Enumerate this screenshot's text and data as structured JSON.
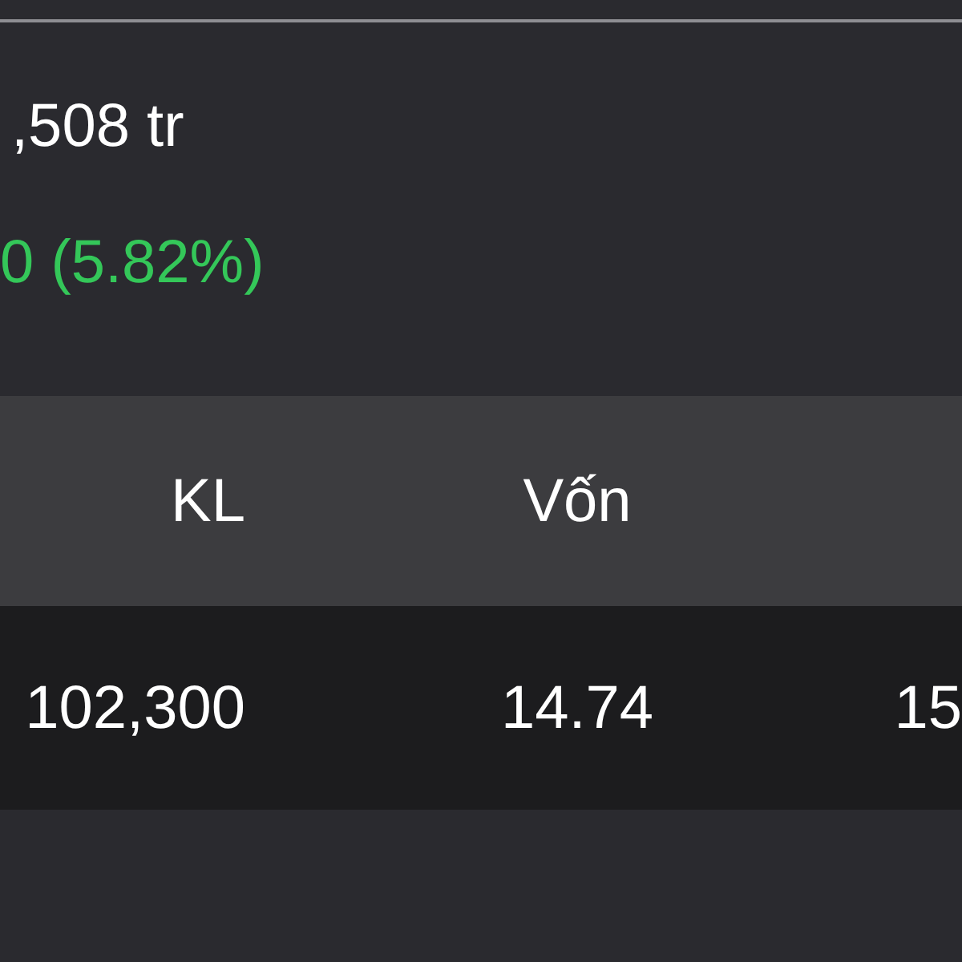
{
  "summary": {
    "value": ",508 tr",
    "change": "0 (5.82%)",
    "rising": true
  },
  "table": {
    "columns": [
      "KL",
      "Vốn"
    ],
    "rows": [
      {
        "cells": [
          "102,300",
          "14.74",
          "15"
        ]
      }
    ]
  }
}
